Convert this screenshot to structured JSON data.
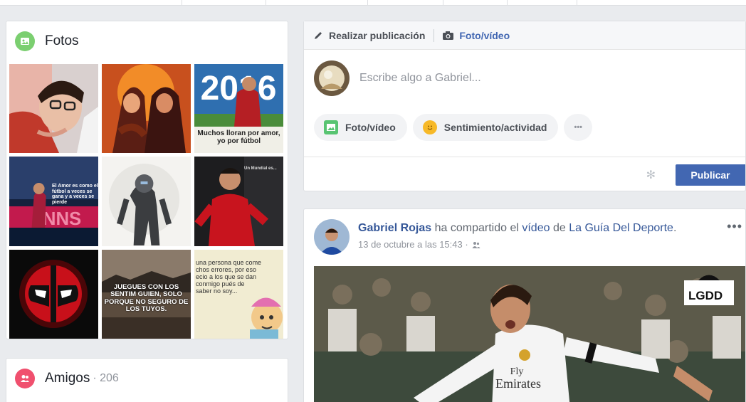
{
  "photos": {
    "title": "Fotos",
    "tiles": [
      {
        "name": "photo-man-glasses"
      },
      {
        "name": "photo-cartoon-characters"
      },
      {
        "name": "photo-2016-soccer",
        "overlay": "2016",
        "caption": "Muchos lloran por amor, yo por fútbol"
      },
      {
        "name": "photo-soccer-quote",
        "caption": "El Amor es como el fútbol a veces se gana y a veces se pierde"
      },
      {
        "name": "photo-space-suit"
      },
      {
        "name": "photo-soccer-player-red",
        "caption": "Un Mundial es..."
      },
      {
        "name": "photo-deadpool-logo"
      },
      {
        "name": "photo-city-quote",
        "caption": "JUEGUES CON LOS SENTIM GUIEN, SOLO PORQUE NO SEGURO DE LOS TUYOS."
      },
      {
        "name": "photo-cartoon-quote",
        "caption": "una persona que come chos errores, por eso ecio a los que se dan conmigo pués de saber no soy..."
      }
    ]
  },
  "friends": {
    "title": "Amigos",
    "count": "· 206"
  },
  "composer": {
    "tab_post": "Realizar publicación",
    "tab_media": "Foto/vídeo",
    "placeholder": "Escribe algo a Gabriel...",
    "pill_media": "Foto/vídeo",
    "pill_feeling": "Sentimiento/actividad",
    "pill_more": "•••",
    "publish": "Publicar"
  },
  "post": {
    "author": "Gabriel Rojas",
    "action1": "ha compartido el",
    "link_video": "vídeo",
    "action2": "de",
    "page": "La Guía Del Deporte",
    "period": ".",
    "date": "13 de octubre a las 15:43 ·",
    "more": "•••",
    "media_badge": "LGDD",
    "shirt_text1": "Fly",
    "shirt_text2": "Emirates"
  },
  "colors": {
    "brand": "#4267b2",
    "link": "#365899",
    "photos_icon": "#7bcf70",
    "friends_icon": "#f0506e",
    "feeling_icon": "#f7b928"
  }
}
